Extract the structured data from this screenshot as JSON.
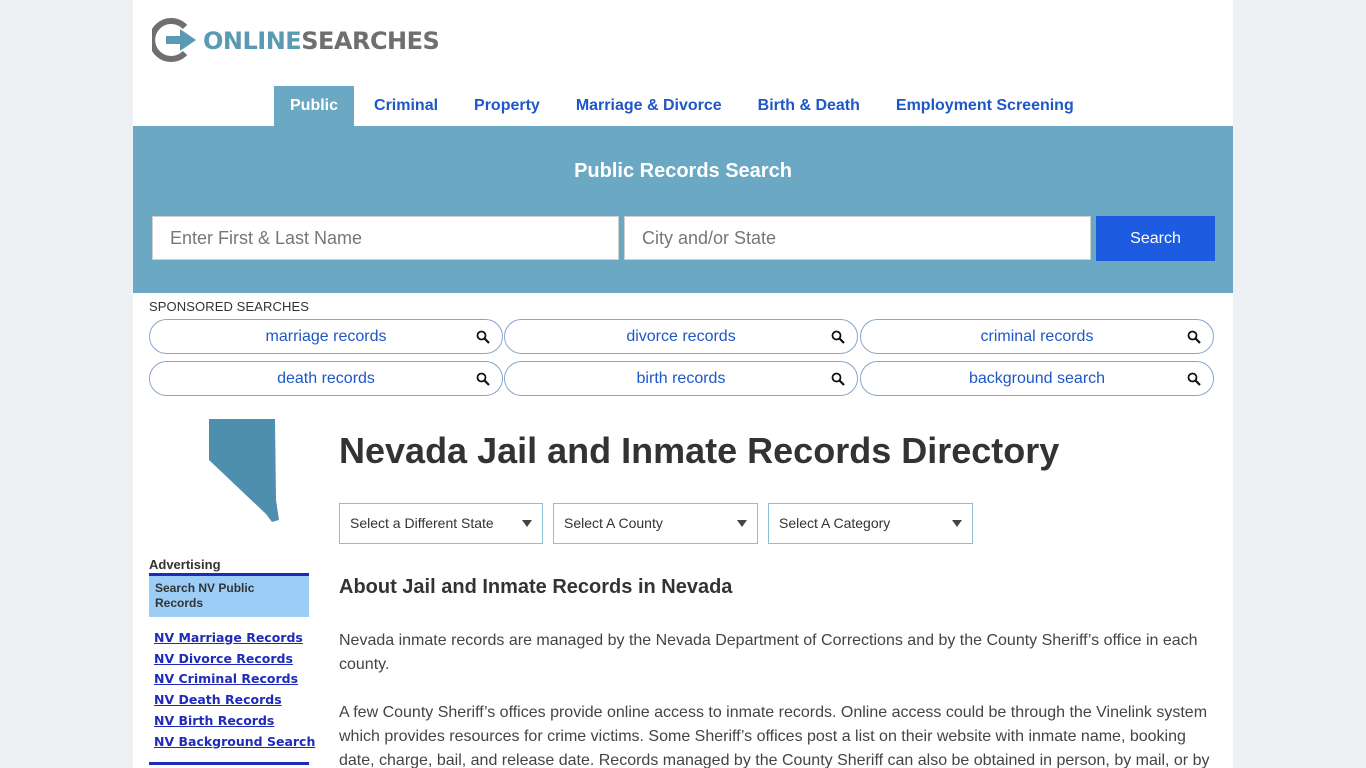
{
  "brand": {
    "logo_part1": "ONLINE",
    "logo_part2": "SEARCHES",
    "logo_color": "#5a9ab4"
  },
  "nav": {
    "items": [
      {
        "label": "Public",
        "active": true
      },
      {
        "label": "Criminal",
        "active": false
      },
      {
        "label": "Property",
        "active": false
      },
      {
        "label": "Marriage & Divorce",
        "active": false
      },
      {
        "label": "Birth & Death",
        "active": false
      },
      {
        "label": "Employment Screening",
        "active": false
      }
    ]
  },
  "search": {
    "title": "Public Records Search",
    "name_placeholder": "Enter First & Last Name",
    "city_placeholder": "City and/or State",
    "button_label": "Search",
    "banner_color": "#6ba8c3",
    "button_color": "#1d5ce0"
  },
  "sponsored": {
    "label": "SPONSORED SEARCHES",
    "items": [
      "marriage records",
      "divorce records",
      "criminal records",
      "death records",
      "birth records",
      "background search"
    ]
  },
  "sidebar": {
    "state_map_icon": "nevada-map-icon",
    "advertising_label": "Advertising",
    "ad_box_text": "Search NV Public Records",
    "links": [
      "NV Marriage Records",
      "NV Divorce Records",
      "NV Criminal Records",
      "NV Death Records",
      "NV Birth Records",
      "NV Background Search"
    ]
  },
  "main": {
    "title": "Nevada Jail and Inmate Records Directory",
    "select_state": "Select a Different State",
    "select_county": "Select A County",
    "select_category": "Select A Category",
    "section_heading": "About Jail and Inmate Records in Nevada",
    "paragraph1": "Nevada inmate records are managed by the Nevada Department of Corrections and by the County Sheriff’s office in each county.",
    "paragraph2": "A few County Sheriff’s offices provide online access to inmate records. Online access could be through the Vinelink system which provides resources for crime victims. Some Sheriff’s offices post a list on their website with inmate name, booking date, charge, bail, and release date. Records managed by the County Sheriff can also be obtained in person, by mail, or by"
  }
}
